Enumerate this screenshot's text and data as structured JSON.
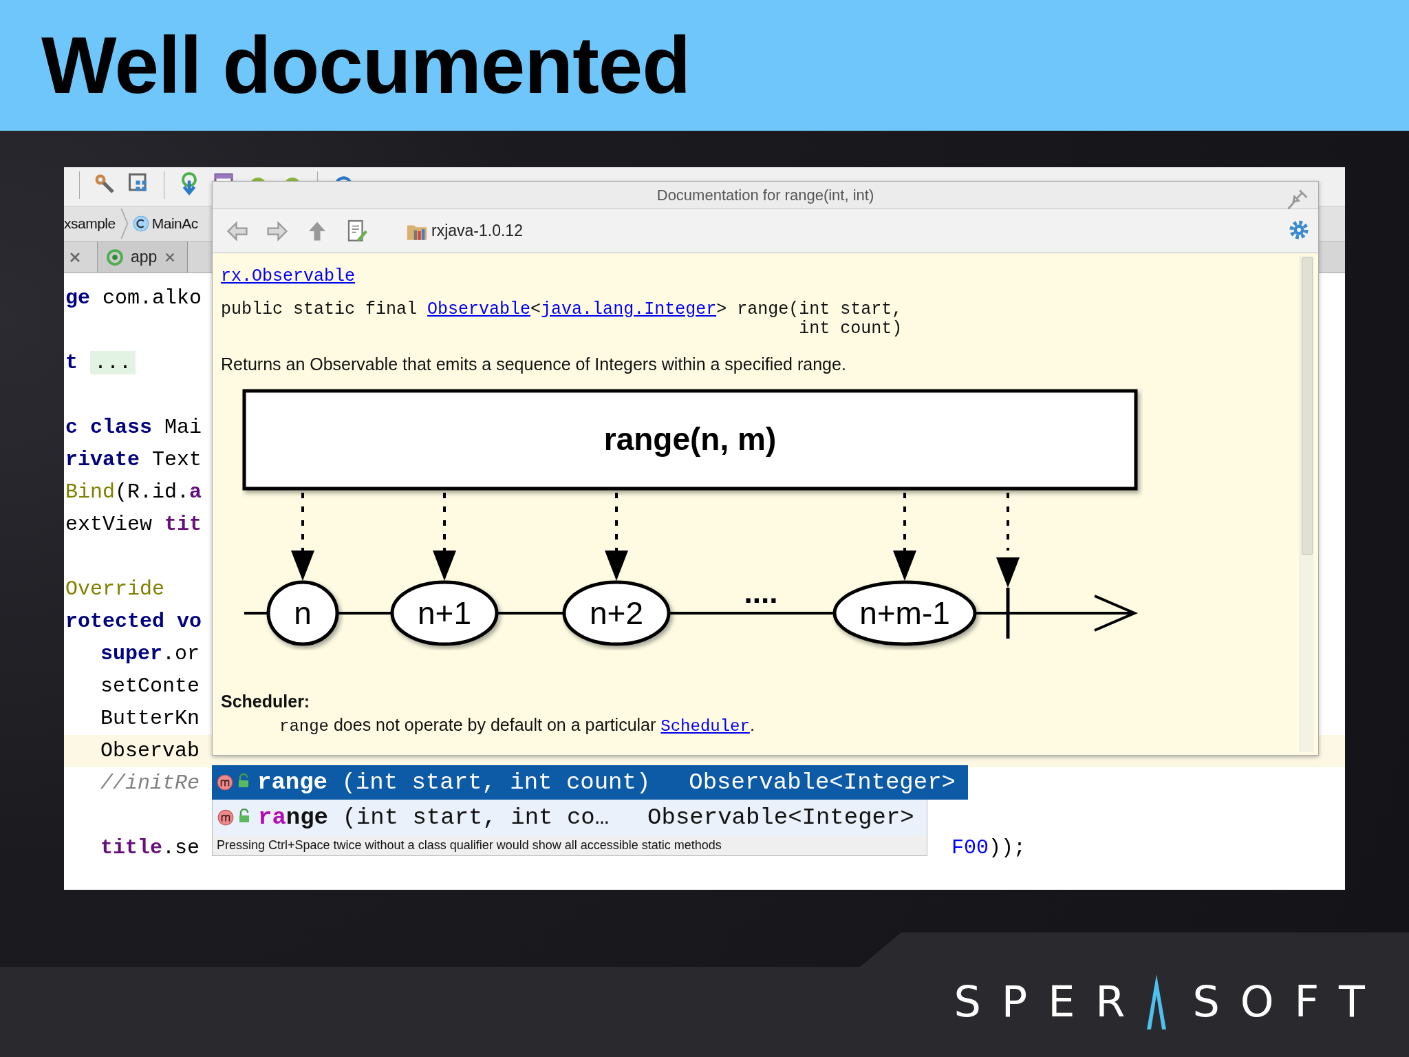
{
  "slide": {
    "title": "Well documented"
  },
  "ide": {
    "breadcrumbs": [
      {
        "label": "xsample",
        "kind": "module"
      },
      {
        "label": "MainAc",
        "kind": "class"
      }
    ],
    "tabs": [
      {
        "label": "app"
      }
    ],
    "code_lines": [
      {
        "kind": "top",
        "current": false,
        "tokens": [
          {
            "kind": "keyword",
            "text": "ge"
          },
          {
            "kind": "plain",
            "text": " com.alko"
          }
        ]
      },
      {
        "kind": "blank"
      },
      {
        "kind": "top",
        "current": false,
        "tokens": [
          {
            "kind": "keyword",
            "text": "t"
          },
          {
            "kind": "folded",
            "text": "..."
          }
        ]
      },
      {
        "kind": "blank"
      },
      {
        "kind": "top",
        "current": false,
        "tokens": [
          {
            "kind": "keyword",
            "text": "c class"
          },
          {
            "kind": "plain",
            "text": " Mai"
          }
        ]
      },
      {
        "kind": "top",
        "current": false,
        "tokens": [
          {
            "kind": "keyword",
            "text": "rivate"
          },
          {
            "kind": "plain",
            "text": " Text"
          }
        ]
      },
      {
        "kind": "top",
        "current": false,
        "tokens": [
          {
            "kind": "annotation",
            "text": "Bind"
          },
          {
            "kind": "plain",
            "text": "(R.id."
          },
          {
            "kind": "field",
            "text": "a"
          }
        ]
      },
      {
        "kind": "top",
        "current": false,
        "tokens": [
          {
            "kind": "plain",
            "text": "extView "
          },
          {
            "kind": "field",
            "text": "tit"
          }
        ]
      },
      {
        "kind": "blank"
      },
      {
        "kind": "top",
        "current": false,
        "tokens": [
          {
            "kind": "annotation",
            "text": "Override"
          }
        ]
      },
      {
        "kind": "top",
        "current": false,
        "tokens": [
          {
            "kind": "keyword",
            "text": "rotected vo"
          }
        ]
      },
      {
        "kind": "nested",
        "current": false,
        "tokens": [
          {
            "kind": "keyword",
            "text": "super"
          },
          {
            "kind": "plain",
            "text": ".or"
          }
        ]
      },
      {
        "kind": "nested",
        "current": false,
        "tokens": [
          {
            "kind": "plain",
            "text": "setConte"
          }
        ]
      },
      {
        "kind": "nested",
        "current": false,
        "tokens": [
          {
            "kind": "plain",
            "text": "ButterKn"
          }
        ]
      },
      {
        "kind": "nested",
        "current": true,
        "tokens": [
          {
            "kind": "plain",
            "text": "Observab"
          }
        ]
      },
      {
        "kind": "nested",
        "current": false,
        "tokens": [
          {
            "kind": "comment",
            "text": "//initRe"
          }
        ]
      },
      {
        "kind": "blank"
      },
      {
        "kind": "nested",
        "current": false,
        "tokens": [
          {
            "kind": "field",
            "text": "title"
          },
          {
            "kind": "plain",
            "text": ".se"
          }
        ],
        "tail": [
          {
            "kind": "number",
            "text": "F00"
          },
          {
            "kind": "plain",
            "text": "));"
          }
        ]
      }
    ]
  },
  "documentation": {
    "title": "Documentation for range(int, int)",
    "library": "rxjava-1.0.12",
    "class_link": "rx.Observable",
    "signature": {
      "prefix": "public static final ",
      "return_type": "Observable",
      "open": "<",
      "type_arg": "java.lang.Integer",
      "rest": "> range(int start,",
      "continuation": "int count)"
    },
    "description": "Returns an Observable that emits a sequence of Integers within a specified range.",
    "diagram": {
      "operator": "range(n, m)",
      "items": [
        "n",
        "n+1",
        "n+2",
        "n+m-1"
      ],
      "ellipsis": "...."
    },
    "scheduler_heading": "Scheduler:",
    "scheduler_note": {
      "code": "range",
      "text": " does not operate by default on a particular ",
      "link": "Scheduler",
      "end": "."
    }
  },
  "completion": {
    "items": [
      {
        "selected": true,
        "match": "ra",
        "name_rest": "nge",
        "params": " (int start, int count)",
        "type": "Observable<Integer>"
      },
      {
        "selected": false,
        "match": "ra",
        "name_rest": "nge",
        "params": " (int start, int co…",
        "type": "Observable<Integer>"
      }
    ],
    "hint": "Pressing Ctrl+Space twice without a class qualifier would show all accessible static methods"
  },
  "logo": {
    "left": "SPER",
    "right": "SOFT"
  }
}
